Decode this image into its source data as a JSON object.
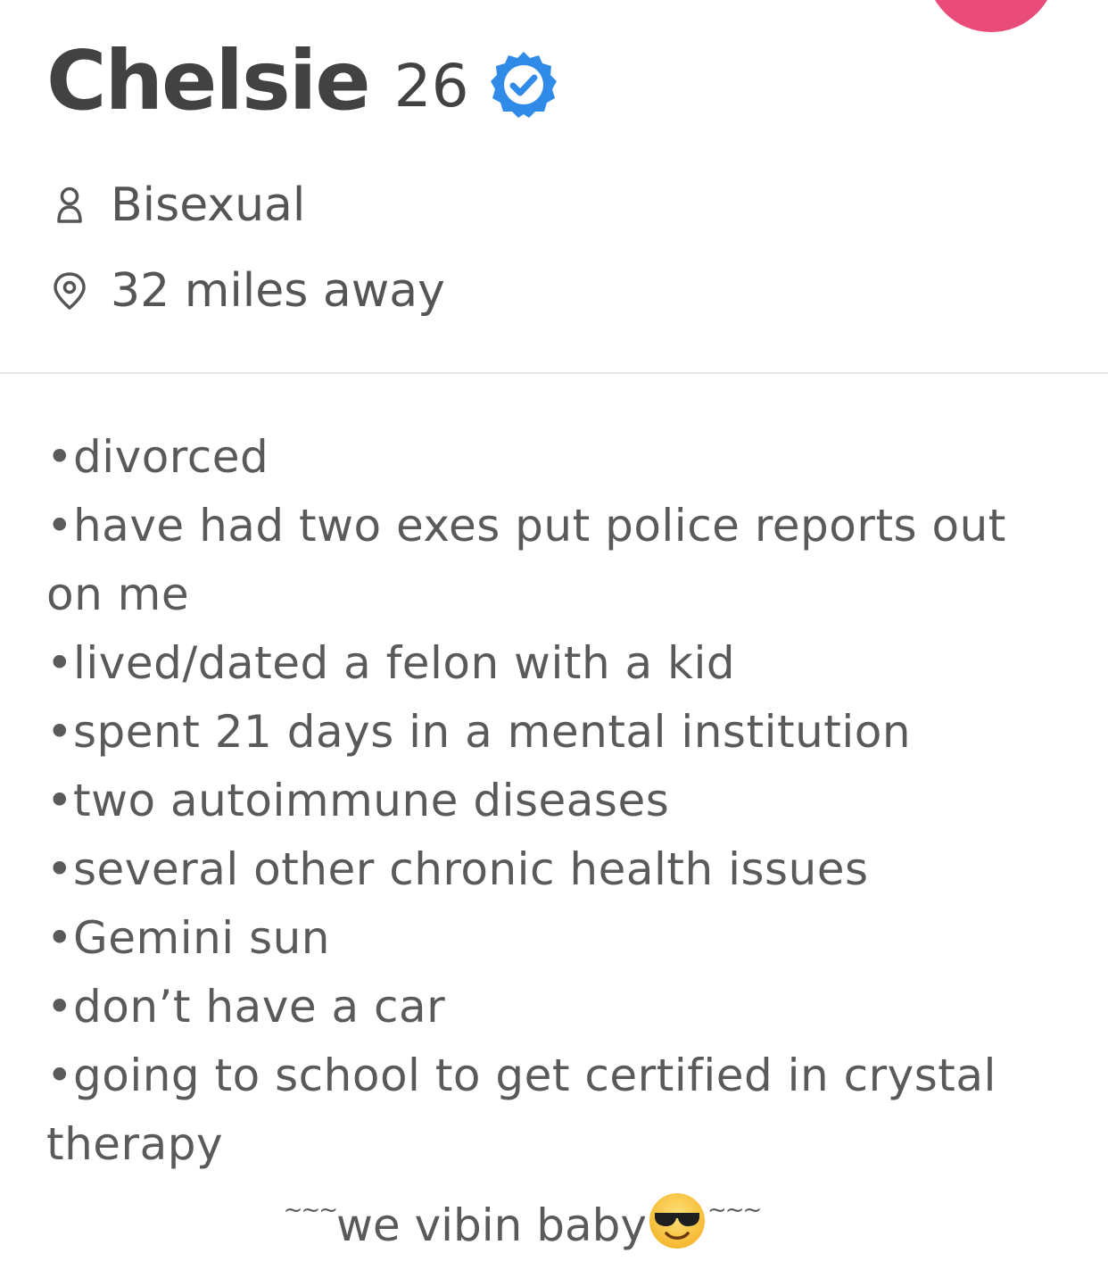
{
  "colors": {
    "accent": "#ea4c79",
    "verified": "#2f8ae8",
    "name_text": "#424242",
    "body_text": "#5a5a5a"
  },
  "profile": {
    "name": "Chelsie",
    "age": "26",
    "verified_icon": "verified-badge-icon",
    "orientation_icon": "person-icon",
    "orientation": "Bisexual",
    "distance_icon": "location-pin-icon",
    "distance": "32 miles away"
  },
  "bio": {
    "lines": [
      "•divorced",
      "•have had two exes put police reports out on me",
      "•lived/dated a felon with a kid",
      "•spent 21 days in a mental institution",
      "•two autoimmune diseases",
      "•several other chronic health issues",
      "•Gemini sun",
      "•don’t have a car",
      "•going to school to get certified in crystal therapy"
    ],
    "closing_prefix": "~~~",
    "closing_text": "we vibin baby",
    "closing_emoji": "smiling-face-with-sunglasses-icon",
    "closing_suffix": "~~~"
  }
}
